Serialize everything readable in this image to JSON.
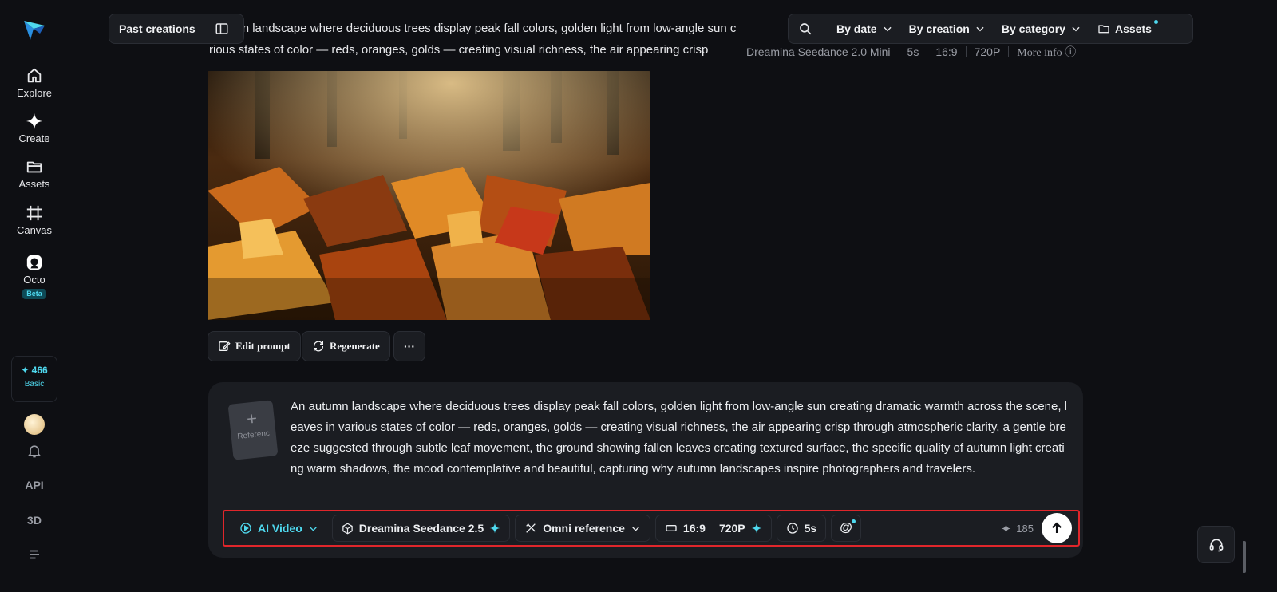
{
  "sidebar": {
    "items": [
      {
        "label": "Explore",
        "icon": "home-icon"
      },
      {
        "label": "Create",
        "icon": "sparkle-icon"
      },
      {
        "label": "Assets",
        "icon": "folder-icon"
      },
      {
        "label": "Canvas",
        "icon": "canvas-icon"
      },
      {
        "label": "Octo",
        "icon": "octo-icon",
        "badge": "Beta"
      }
    ],
    "credits": {
      "value": "466",
      "plan": "Basic"
    },
    "api_label": "API",
    "three_d_label": "3D"
  },
  "header": {
    "past_creations": "Past creations",
    "filters": [
      "By date",
      "By creation",
      "By category"
    ],
    "assets_label": "Assets"
  },
  "creation": {
    "prompt_line1": "autumn landscape where deciduous trees display peak fall colors, golden light from low-angle sun c",
    "prompt_line2": "rious states of color — reds, oranges, golds — creating visual richness, the air appearing crisp",
    "model": "Dreamina Seedance 2.0 Mini",
    "duration": "5s",
    "ratio": "16:9",
    "resolution": "720P",
    "more_info": "More info"
  },
  "actions": {
    "edit_prompt": "Edit prompt",
    "regenerate": "Regenerate",
    "more": "···"
  },
  "composer": {
    "reference_label": "Referenc",
    "prompt": "An autumn landscape where deciduous trees display peak fall colors, golden light from low-angle sun creating dramatic warmth across the scene, leaves in various states of color — reds, oranges, golds — creating visual richness, the air appearing crisp through atmospheric clarity, a gentle breeze suggested through subtle leaf movement, the ground showing fallen leaves creating textured surface, the specific quality of autumn light creating warm shadows, the mood contemplative and beautiful, capturing why autumn landscapes inspire photographers and travelers.",
    "mode": "AI Video",
    "model": "Dreamina Seedance 2.5",
    "reference_mode": "Omni reference",
    "ratio": "16:9",
    "resolution": "720P",
    "duration": "5s",
    "mention": "@",
    "cost": "185"
  },
  "colors": {
    "accent": "#4fd9ef",
    "highlight": "#e0262b",
    "panel": "#1b1d22"
  }
}
